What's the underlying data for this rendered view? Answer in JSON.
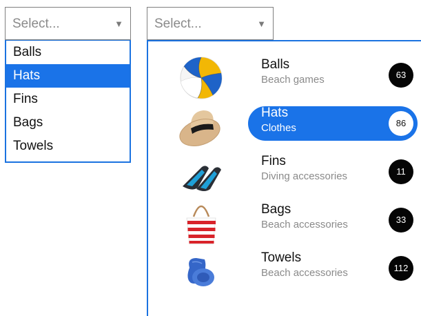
{
  "simple_dropdown": {
    "placeholder": "Select...",
    "arrow": "▼",
    "items": [
      {
        "label": "Balls"
      },
      {
        "label": "Hats"
      },
      {
        "label": "Fins"
      },
      {
        "label": "Bags"
      },
      {
        "label": "Towels"
      }
    ],
    "selected_index": 1
  },
  "rich_dropdown": {
    "placeholder": "Select...",
    "arrow": "▼",
    "items": [
      {
        "label": "Balls",
        "category": "Beach games",
        "count": "63",
        "icon": "volleyball-icon"
      },
      {
        "label": "Hats",
        "category": "Clothes",
        "count": "86",
        "icon": "hat-icon"
      },
      {
        "label": "Fins",
        "category": "Diving accessories",
        "count": "11",
        "icon": "fins-icon"
      },
      {
        "label": "Bags",
        "category": "Beach accessories",
        "count": "33",
        "icon": "bag-icon"
      },
      {
        "label": "Towels",
        "category": "Beach accessories",
        "count": "112",
        "icon": "towel-icon"
      }
    ],
    "selected_index": 1
  },
  "colors": {
    "accent": "#1a73e8",
    "badge": "#050505",
    "border": "#7f7f7f"
  }
}
